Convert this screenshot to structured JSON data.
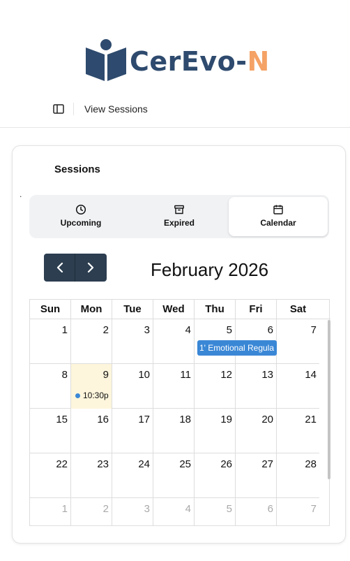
{
  "brand": {
    "name_main": "CerEvo-",
    "name_accent": "N",
    "primary_color": "#2e4a6e",
    "accent_color": "#f5a266"
  },
  "topbar": {
    "toggle_icon": "sidebar-toggle-icon",
    "breadcrumb": "View Sessions"
  },
  "card": {
    "title": "Sessions",
    "stray_mark": ".",
    "tabs": [
      {
        "label": "Upcoming",
        "icon": "clock-icon",
        "active": false
      },
      {
        "label": "Expired",
        "icon": "archive-icon",
        "active": false
      },
      {
        "label": "Calendar",
        "icon": "calendar-icon",
        "active": true
      }
    ]
  },
  "calendar": {
    "month_title": "February 2026",
    "weekdays": [
      "Sun",
      "Mon",
      "Tue",
      "Wed",
      "Thu",
      "Fri",
      "Sat"
    ],
    "weeks": [
      [
        "1",
        "2",
        "3",
        "4",
        "5",
        "6",
        "7"
      ],
      [
        "8",
        "9",
        "10",
        "11",
        "12",
        "13",
        "14"
      ],
      [
        "15",
        "16",
        "17",
        "18",
        "19",
        "20",
        "21"
      ],
      [
        "22",
        "23",
        "24",
        "25",
        "26",
        "27",
        "28"
      ],
      [
        "1",
        "2",
        "3",
        "4",
        "5",
        "6",
        "7"
      ]
    ],
    "event_bar": {
      "text": "1' Emotional Regula",
      "color": "#3a87d6"
    },
    "event_dot": {
      "text": "10:30p",
      "color": "#3a87d6"
    },
    "today_color": "#fdf6dc"
  }
}
